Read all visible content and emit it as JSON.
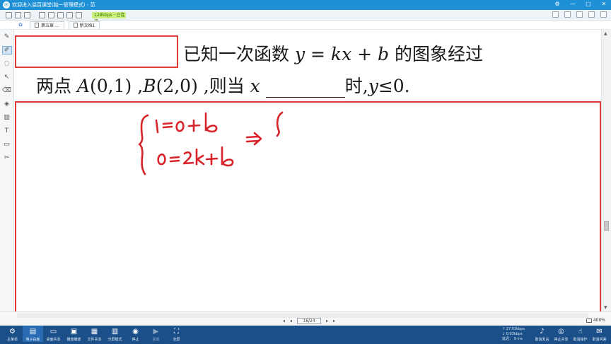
{
  "window": {
    "title": "欢迎进入溢百课堂(独一管理模式) - 范",
    "controls": [
      "⚙",
      "—",
      "□",
      "✕"
    ]
  },
  "toolbar": {
    "badge_text": "128kbps · 已连接",
    "icons": [
      "new-file-icon",
      "open-icon",
      "save-icon",
      "list-icon",
      "print-icon",
      "image-icon",
      "home-icon",
      "settings-icon"
    ]
  },
  "tabs": [
    {
      "label": "第五章 ..."
    },
    {
      "label": "新文档1"
    }
  ],
  "board": {
    "question_line1": "已知一次函数 ",
    "q_eq_y": "y",
    "q_eq_mid": " = ",
    "q_eq_k": "kx",
    "q_eq_plus": " + ",
    "q_eq_b": "b",
    "q_line1_tail": " 的图象经过",
    "q_line2_a": "两点 ",
    "q_A": "A",
    "q_A_coord": "(0,1)",
    "q_sep": " ,",
    "q_B": "B",
    "q_B_coord": "(2,0)",
    "q_mid": " ,则当 ",
    "q_x": "x",
    "q_after_blank": "时,",
    "q_y2": "y",
    "q_end": "≤0."
  },
  "navigation": {
    "page_indicator": "18/24",
    "zoom": "400%"
  },
  "network": {
    "up": "↑ 27.03kbps",
    "down": "↓ 0.03kbps",
    "delay": "延迟： 9 ms"
  },
  "taskbar": {
    "items": [
      {
        "label": "主菜单"
      },
      {
        "label": "电子白板"
      },
      {
        "label": "桌面共享"
      },
      {
        "label": "播放播放"
      },
      {
        "label": "文件共享"
      },
      {
        "label": "分屏模式"
      },
      {
        "label": "停止"
      },
      {
        "label": "回放"
      },
      {
        "label": "全屏"
      }
    ],
    "right_items": [
      {
        "label": "取消发言"
      },
      {
        "label": "停止共享"
      },
      {
        "label": "取消操作"
      },
      {
        "label": "取消问答"
      }
    ]
  },
  "colors": {
    "title_bar": "#1e90d6",
    "taskbar": "#1a4f8a",
    "annotation_red": "#e23b3b",
    "ink_red": "#d9232b"
  }
}
